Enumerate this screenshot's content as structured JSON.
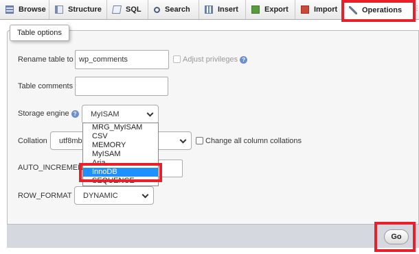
{
  "tabs": [
    {
      "label": "Browse",
      "icon": "browse-icon"
    },
    {
      "label": "Structure",
      "icon": "structure-icon"
    },
    {
      "label": "SQL",
      "icon": "sql-icon"
    },
    {
      "label": "Search",
      "icon": "search-icon"
    },
    {
      "label": "Insert",
      "icon": "insert-icon"
    },
    {
      "label": "Export",
      "icon": "export-icon"
    },
    {
      "label": "Import",
      "icon": "import-icon"
    },
    {
      "label": "Operations",
      "icon": "wrench-icon",
      "active": true
    }
  ],
  "fieldset_title": "Table options",
  "rename": {
    "label": "Rename table to",
    "value": "wp_comments",
    "adjust_label": "Adjust privileges"
  },
  "comments": {
    "label": "Table comments",
    "value": ""
  },
  "storage": {
    "label": "Storage engine",
    "value": "MyISAM",
    "options": [
      "MRG_MyISAM",
      "CSV",
      "MEMORY",
      "MyISAM",
      "Aria",
      "InnoDB",
      "SEQUENCE"
    ],
    "highlighted": "InnoDB"
  },
  "collation": {
    "label": "Collation",
    "value": "utf8mb",
    "change_all_label": "Change all column collations"
  },
  "auto_increment": {
    "label": "AUTO_INCREMENT"
  },
  "row_format": {
    "label": "ROW_FORMAT",
    "value": "DYNAMIC"
  },
  "go_label": "Go",
  "colors": {
    "highlight": "#e8202b",
    "selected_option": "#1e90ff"
  }
}
